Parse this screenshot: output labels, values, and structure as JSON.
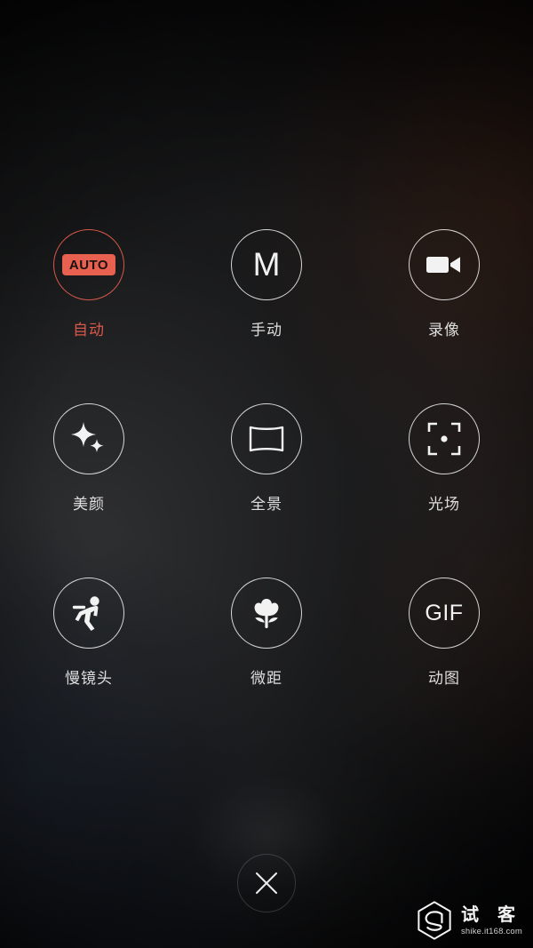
{
  "app": {
    "name": "camera-mode-picker",
    "accent_color": "#d9584b",
    "badge_color": "#e8604f",
    "icon_color": "#f2f2f2"
  },
  "modes": [
    {
      "label": "自动",
      "icon": "auto-badge-icon",
      "badge_text": "AUTO",
      "active": true
    },
    {
      "label": "手动",
      "icon": "manual-m-icon",
      "glyph": "M",
      "active": false
    },
    {
      "label": "录像",
      "icon": "video-camera-icon",
      "active": false
    },
    {
      "label": "美颜",
      "icon": "beauty-sparkle-icon",
      "active": false
    },
    {
      "label": "全景",
      "icon": "panorama-icon",
      "active": false
    },
    {
      "label": "光场",
      "icon": "light-field-focus-icon",
      "active": false
    },
    {
      "label": "慢镜头",
      "icon": "slow-motion-runner-icon",
      "active": false
    },
    {
      "label": "微距",
      "icon": "macro-flower-icon",
      "active": false
    },
    {
      "label": "动图",
      "icon": "gif-text-icon",
      "glyph": "GIF",
      "active": false
    }
  ],
  "close_button": {
    "icon": "close-x-icon",
    "label": ""
  },
  "watermark": {
    "logo": "shike-hexagon-logo",
    "brand": "试 客",
    "url": "shike.it168.com"
  }
}
